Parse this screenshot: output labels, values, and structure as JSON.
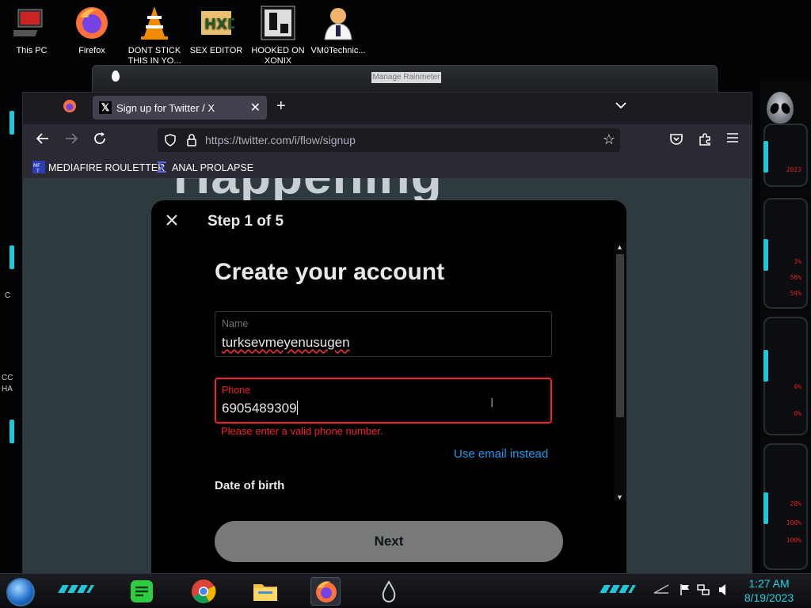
{
  "desktop": {
    "icons": [
      {
        "label": "This PC"
      },
      {
        "label": "Firefox"
      },
      {
        "label": "DONT STICK THIS IN YO..."
      },
      {
        "label": "SEX EDITOR"
      },
      {
        "label": "HOOKED ON XONIX"
      },
      {
        "label": "VM0Technic..."
      }
    ],
    "edge_fragments": [
      "C",
      "CC",
      "HA"
    ]
  },
  "background_window": {
    "title": "Manage Rainmeter"
  },
  "browser": {
    "tab": {
      "title": "Sign up for Twitter / X",
      "close": "✕"
    },
    "new_tab": "+",
    "tab_list": "⌄",
    "url": "https://twitter.com/i/flow/signup",
    "bookmarks": [
      {
        "label": "MEDIAFIRE ROULETTER",
        "icon": "mediafire-icon"
      },
      {
        "label": "ANAL PROLAPSE",
        "icon": "sigma-icon"
      }
    ],
    "page_headline": "Happening"
  },
  "modal": {
    "step": "Step 1 of 5",
    "title": "Create your account",
    "name": {
      "label": "Name",
      "value": "turksevmeyenusugen"
    },
    "phone": {
      "label": "Phone",
      "value": "6905489309"
    },
    "error": "Please enter a valid phone number.",
    "use_email": "Use email instead",
    "dob_label": "Date of birth",
    "next": "Next"
  },
  "rainmeter": {
    "values": [
      "2023",
      "3%",
      "56%",
      "54%",
      "0%",
      "0%",
      "28%",
      "100%",
      "100%"
    ]
  },
  "taskbar": {
    "time": "1:27 AM",
    "date": "8/19/2023"
  },
  "colors": {
    "accent_blue": "#1d9bf0",
    "error_red": "#f4212e",
    "modal_bg": "#000000",
    "page_bg": "#2d3a3e",
    "clock_cyan": "#22d3e6"
  }
}
